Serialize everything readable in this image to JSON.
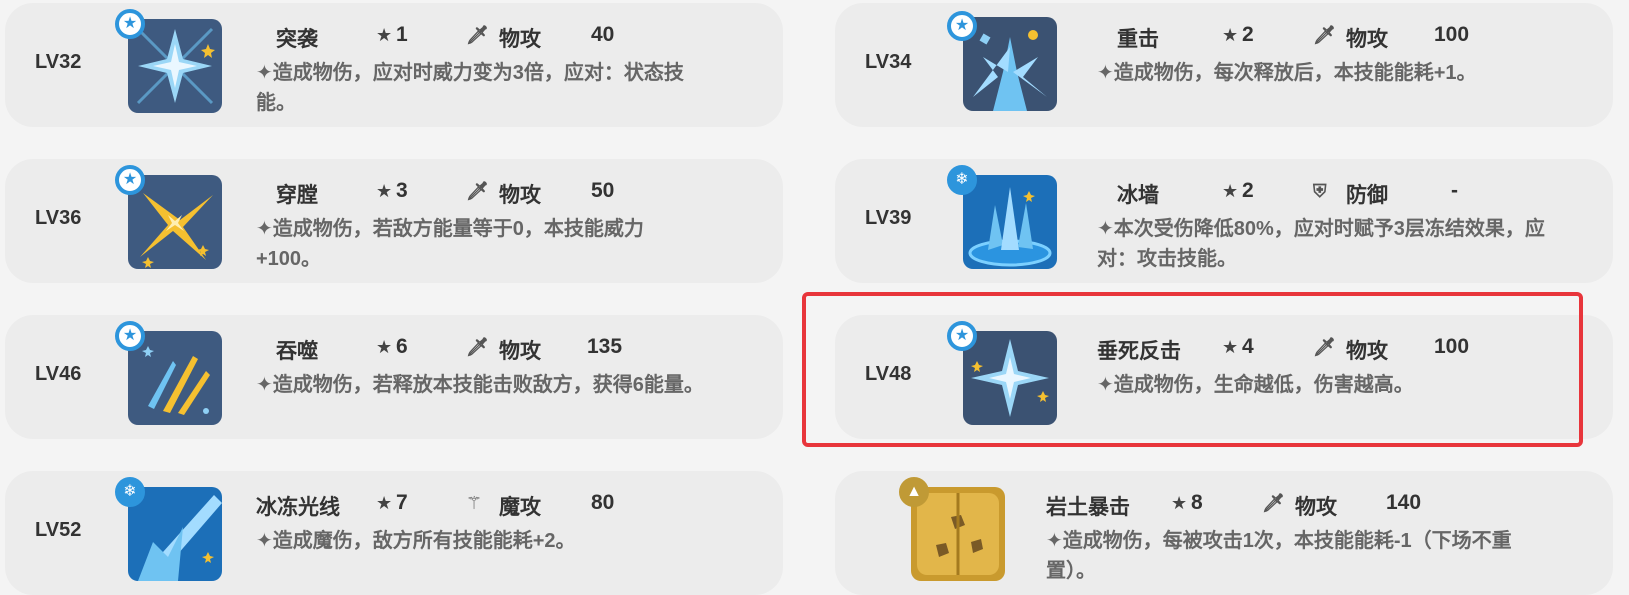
{
  "cards": [
    {
      "level": "LV32",
      "name": "突袭",
      "star": "1",
      "type_icon": "sword-icon",
      "type": "物攻",
      "power": "40",
      "desc": "✦造成物伤，应对时威力变为3倍，应对：状态技能。",
      "badge": "star-badge-icon"
    },
    {
      "level": "LV34",
      "name": "重击",
      "star": "2",
      "type_icon": "sword-icon",
      "type": "物攻",
      "power": "100",
      "desc": "✦造成物伤，每次释放后，本技能能耗+1。",
      "badge": "star-badge-icon"
    },
    {
      "level": "LV36",
      "name": "穿膛",
      "star": "3",
      "type_icon": "sword-icon",
      "type": "物攻",
      "power": "50",
      "desc": "✦造成物伤，若敌方能量等于0，本技能威力+100。",
      "badge": "star-badge-icon"
    },
    {
      "level": "LV39",
      "name": "冰墙",
      "star": "2",
      "type_icon": "shield-icon",
      "type": "防御",
      "power": "-",
      "desc": "✦本次受伤降低80%，应对时赋予3层冻结效果，应对：攻击技能。",
      "badge": "snowflake-badge-icon"
    },
    {
      "level": "LV46",
      "name": "吞噬",
      "star": "6",
      "type_icon": "sword-icon",
      "type": "物攻",
      "power": "135",
      "desc": "✦造成物伤，若释放本技能击败敌方，获得6能量。",
      "badge": "star-badge-icon"
    },
    {
      "level": "LV48",
      "name": "垂死反击",
      "star": "4",
      "type_icon": "sword-icon",
      "type": "物攻",
      "power": "100",
      "desc": "✦造成物伤，生命越低，伤害越高。",
      "badge": "star-badge-icon"
    },
    {
      "level": "LV52",
      "name": "冰冻光线",
      "star": "7",
      "type_icon": "magic-wand-icon",
      "type": "魔攻",
      "power": "80",
      "desc": "✦造成魔伤，敌方所有技能能耗+2。",
      "badge": "snowflake-badge-icon"
    },
    {
      "level": "",
      "name": "岩土暴击",
      "star": "8",
      "type_icon": "sword-icon",
      "type": "物攻",
      "power": "140",
      "desc": "✦造成物伤，每被攻击1次，本技能能耗-1（下场不重置）。",
      "badge": "mountain-badge-icon"
    }
  ],
  "colors": {
    "accent": "#2d95dc",
    "highlight": "#e8353b",
    "rock": "#c09a36"
  }
}
